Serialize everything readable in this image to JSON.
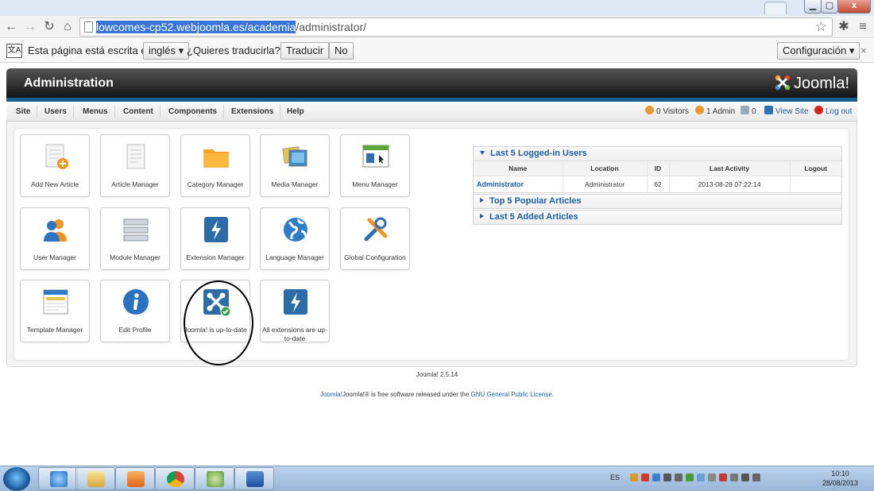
{
  "browser": {
    "url_selected": "lowcomes-cp52.webjoomla.es/academia",
    "url_rest": "/administrator/",
    "close_glyph": "x"
  },
  "translate": {
    "prefix": "Esta página está escrita en",
    "language": "inglés",
    "question": "¿Quieres traducirla?",
    "translate_button": "Traducir",
    "no_button": "No",
    "settings_button": "Configuración"
  },
  "admin": {
    "title": "Administration",
    "logo_text": "Joomla!"
  },
  "menu": [
    "Site",
    "Users",
    "Menus",
    "Content",
    "Components",
    "Extensions",
    "Help"
  ],
  "status": {
    "visitors": "0 Visitors",
    "admins": "1 Admin",
    "messages": "0",
    "view_site": "View Site",
    "logout": "Log out"
  },
  "quick_icons": [
    {
      "label": "Add New Article",
      "icon": "add-article-icon"
    },
    {
      "label": "Article Manager",
      "icon": "article-icon"
    },
    {
      "label": "Category Manager",
      "icon": "folder-icon"
    },
    {
      "label": "Media Manager",
      "icon": "media-icon"
    },
    {
      "label": "Menu Manager",
      "icon": "menu-icon"
    },
    {
      "label": "User Manager",
      "icon": "user-icon"
    },
    {
      "label": "Module Manager",
      "icon": "module-icon"
    },
    {
      "label": "Extension Manager",
      "icon": "extension-icon"
    },
    {
      "label": "Language Manager",
      "icon": "globe-icon"
    },
    {
      "label": "Global Configuration",
      "icon": "tools-icon"
    },
    {
      "label": "Template Manager",
      "icon": "template-icon"
    },
    {
      "label": "Edit Profile",
      "icon": "info-icon"
    },
    {
      "label": "Joomla! is up-to-date",
      "icon": "joomla-update-icon"
    },
    {
      "label": "All extensions are up-to-date",
      "icon": "extension-update-icon"
    }
  ],
  "modules": {
    "logged_in": {
      "title": "Last 5 Logged-in Users",
      "columns": [
        "Name",
        "Location",
        "ID",
        "Last Activity",
        "Logout"
      ],
      "rows": [
        {
          "name": "Administrator",
          "location": "Administrator",
          "id": "62",
          "activity": "2013-08-28 07:22:14",
          "logout": ""
        }
      ]
    },
    "popular": {
      "title": "Top 5 Popular Articles"
    },
    "added": {
      "title": "Last 5 Added Articles"
    }
  },
  "footer": {
    "version": "Joomla! 2.5.14",
    "license_prefix": "Joomla!® is free software released under the ",
    "license_link": "GNU General Public License",
    "license_suffix": "."
  },
  "taskbar": {
    "language": "ES",
    "time": "10:10",
    "date": "28/08/2013"
  },
  "colors": {
    "accent": "#1b5da3",
    "header_dark": "#141414",
    "stripe": "#1a5f91"
  }
}
